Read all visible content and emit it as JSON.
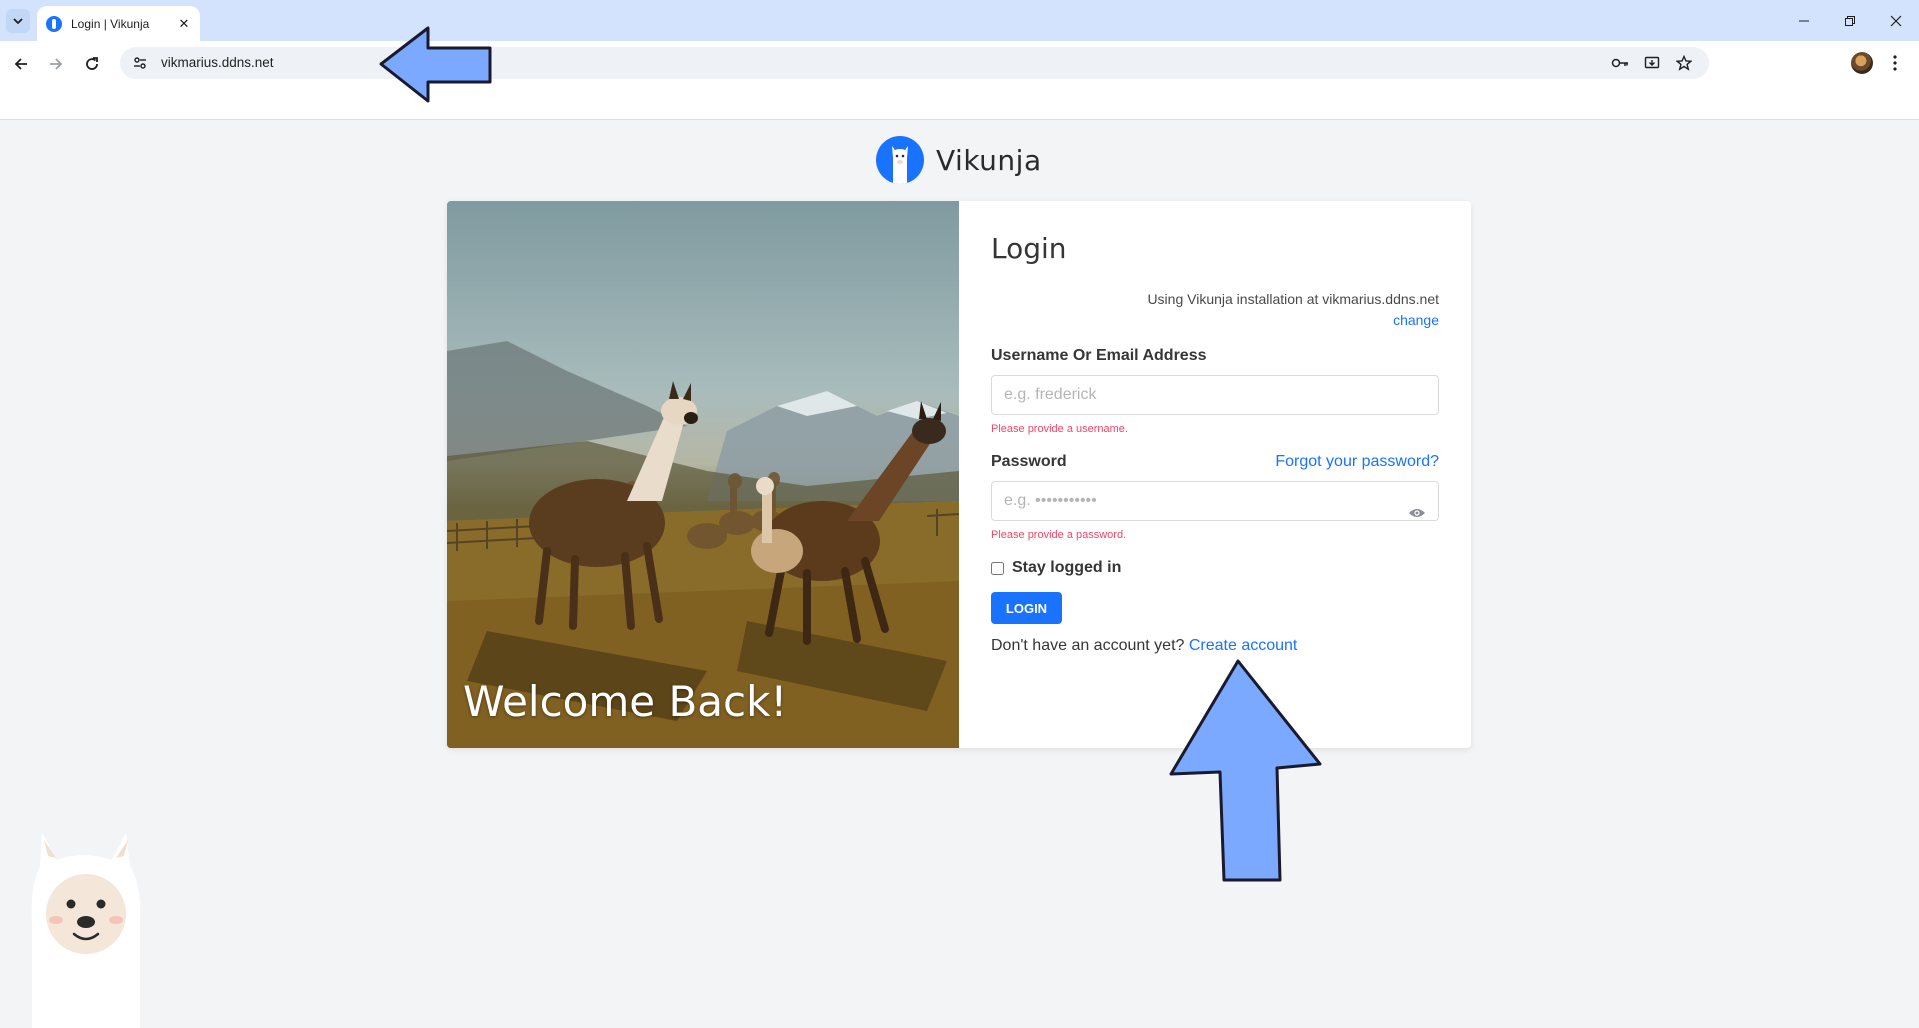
{
  "browser": {
    "tab_title": "Login | Vikunja",
    "url": "vikmarius.ddns.net"
  },
  "page": {
    "brand_name": "Vikunja",
    "hero_text": "Welcome Back!",
    "form": {
      "title": "Login",
      "install_info": "Using Vikunja installation at vikmarius.ddns.net",
      "change_link": "change",
      "username_label": "Username Or Email Address",
      "username_placeholder": "e.g. frederick",
      "username_error": "Please provide a username.",
      "password_label": "Password",
      "forgot_link": "Forgot your password?",
      "password_placeholder": "e.g. •••••••••••",
      "password_error": "Please provide a password.",
      "stay_logged_in": "Stay logged in",
      "login_button": "LOGIN",
      "no_account_text": "Don't have an account yet?",
      "create_account_link": "Create account"
    }
  },
  "colors": {
    "primary": "#1973ff",
    "danger": "#f14668",
    "annotation_arrow": "#7aa9ff"
  }
}
